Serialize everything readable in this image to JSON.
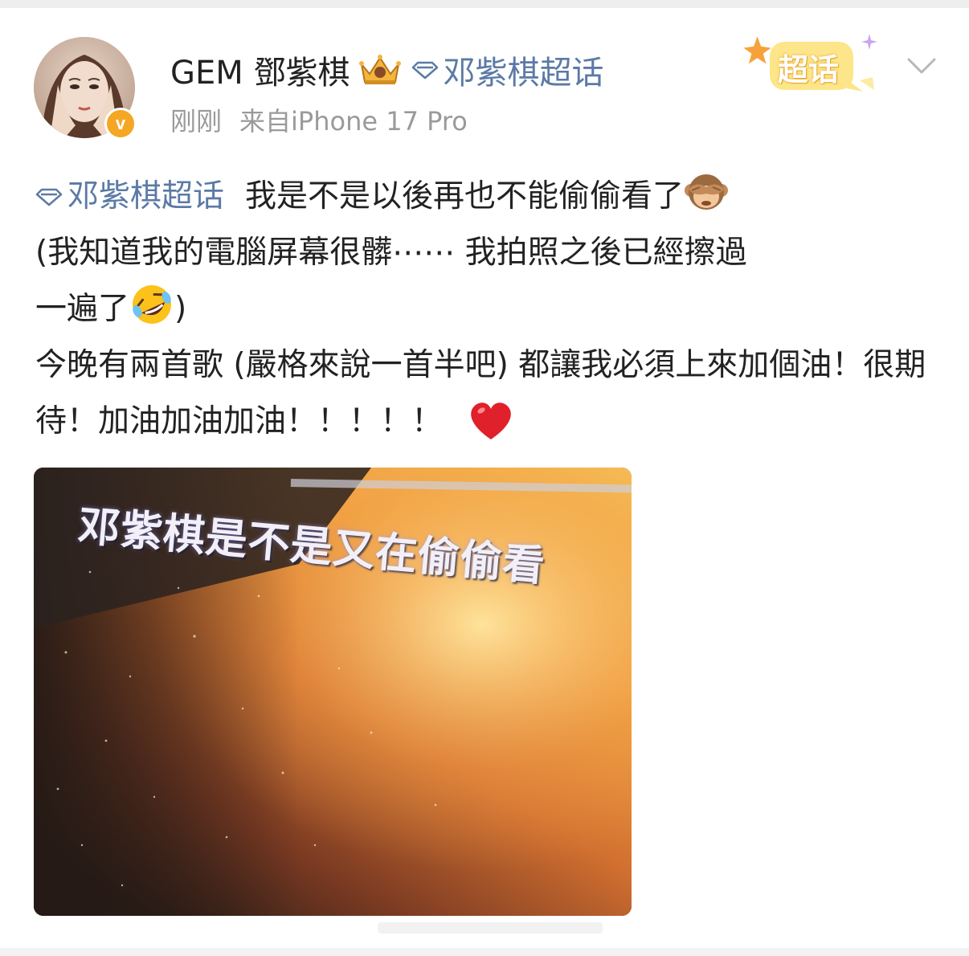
{
  "user": {
    "name": "GEM 鄧紫棋",
    "verified_mark": "v"
  },
  "header_topic": "邓紫棋超话",
  "meta": {
    "time": "刚刚",
    "source": "来自iPhone 17 Pro"
  },
  "sticker": {
    "label": "超话"
  },
  "post": {
    "topic": "邓紫棋超话",
    "line1": "我是不是以後再也不能偷偷看了",
    "line2": "(我知道我的電腦屏幕很髒⋯⋯ 我拍照之後已經擦過",
    "line3_a": "一遍了",
    "line3_b": ")",
    "para2": "今晚有兩首歌 (嚴格來說一首半吧) 都讓我必須上來加個油！很期待！加油加油加油！！！！！"
  },
  "photo": {
    "caption": "邓紫棋是不是又在偷偷看"
  },
  "colors": {
    "topic_blue": "#5b7aa6",
    "meta_gray": "#9a9a9a",
    "verified_orange": "#f5a623",
    "heart_red": "#e0202a"
  },
  "icons": {
    "crown": "crown-icon",
    "topic": "diamond-icon",
    "expand": "chevron-down-icon",
    "monkey": "see-no-evil-monkey-emoji",
    "laugh": "rolling-laughing-emoji",
    "heart": "red-heart-emoji"
  }
}
